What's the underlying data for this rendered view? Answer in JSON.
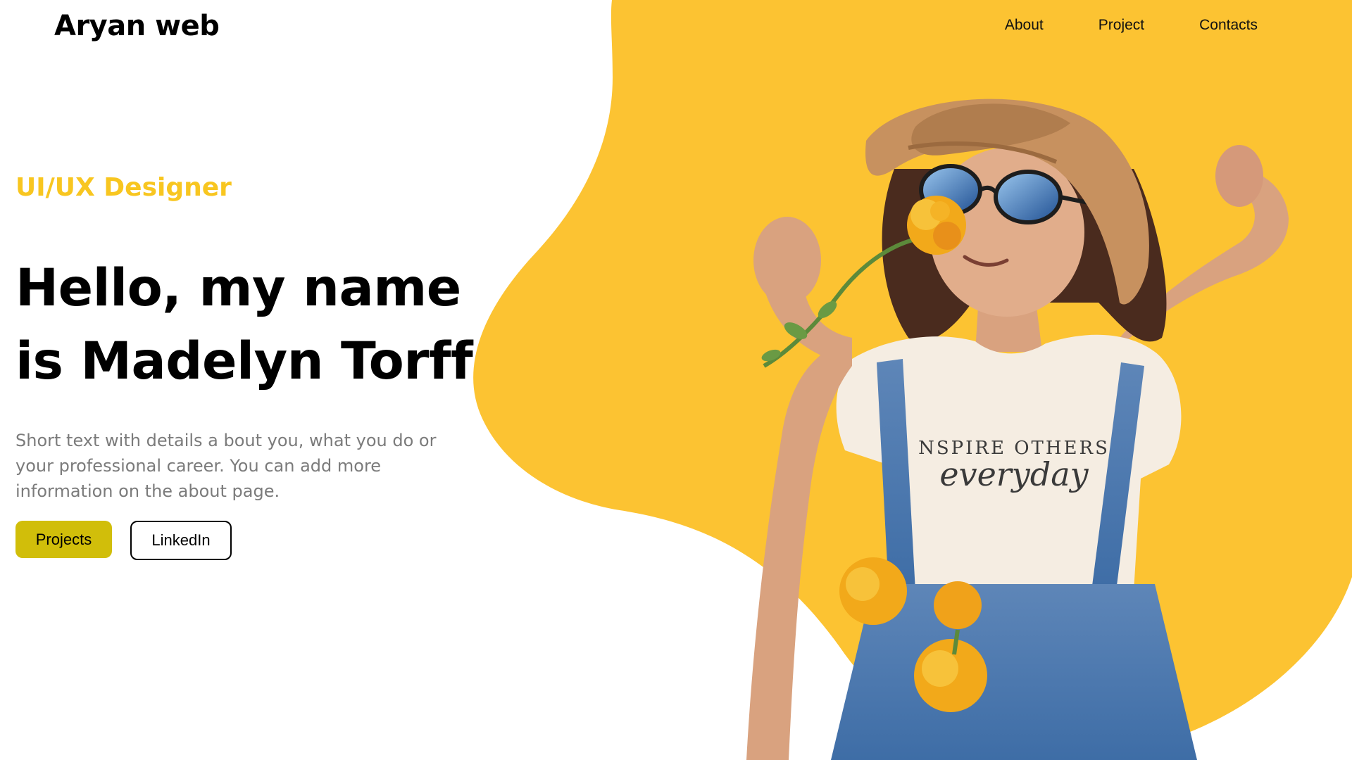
{
  "brand": {
    "name": "Aryan web"
  },
  "nav": {
    "items": [
      {
        "label": "About"
      },
      {
        "label": "Project"
      },
      {
        "label": "Contacts"
      }
    ]
  },
  "hero": {
    "role": "UI/UX Designer",
    "headline_line1": "Hello, my name",
    "headline_line2": "is Madelyn Torff",
    "description": "Short text with details a bout you, what you do or your professional career. You can add more information on the about page.",
    "buttons": {
      "primary": "Projects",
      "secondary": "LinkedIn"
    },
    "portrait": {
      "shirt_text_1": "NSPIRE OTHERS",
      "shirt_text_2": "everyday"
    }
  },
  "colors": {
    "accent_yellow": "#fcc332",
    "role_text": "#f8c620",
    "primary_button": "#d1be0a",
    "body_text": "#7b7b7b"
  }
}
